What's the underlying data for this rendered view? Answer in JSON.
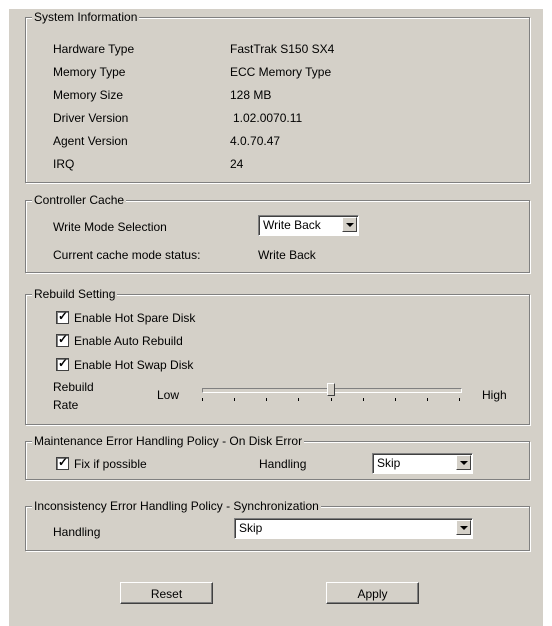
{
  "system_info": {
    "legend": "System Information",
    "rows": [
      {
        "label": "Hardware Type",
        "value": "FastTrak S150 SX4"
      },
      {
        "label": "Memory Type",
        "value": "ECC Memory Type"
      },
      {
        "label": "Memory Size",
        "value": "128 MB"
      },
      {
        "label": "Driver Version",
        "value": "1.02.0070.11"
      },
      {
        "label": "Agent Version",
        "value": "4.0.70.47"
      },
      {
        "label": "IRQ",
        "value": "24"
      }
    ]
  },
  "controller_cache": {
    "legend": "Controller Cache",
    "write_mode_label": "Write Mode Selection",
    "write_mode_value": "Write Back",
    "status_label": "Current cache mode status:",
    "status_value": "Write Back"
  },
  "rebuild": {
    "legend": "Rebuild Setting",
    "hot_spare": {
      "label": "Enable Hot Spare Disk",
      "checked": true
    },
    "auto_rebuild": {
      "label": "Enable Auto Rebuild",
      "checked": true
    },
    "hot_swap": {
      "label": "Enable Hot Swap Disk",
      "checked": true
    },
    "rate_label_line1": "Rebuild",
    "rate_label_line2": "Rate",
    "low_label": "Low",
    "high_label": "High",
    "rate_fraction": 0.5
  },
  "maintenance": {
    "legend": "Maintenance Error Handling Policy - On Disk Error",
    "fix_label": "Fix if possible",
    "fix_checked": true,
    "handling_label": "Handling",
    "handling_value": "Skip"
  },
  "inconsistency": {
    "legend": "Inconsistency Error Handling Policy - Synchronization",
    "handling_label": "Handling",
    "handling_value": "Skip"
  },
  "buttons": {
    "reset": "Reset",
    "apply": "Apply"
  }
}
